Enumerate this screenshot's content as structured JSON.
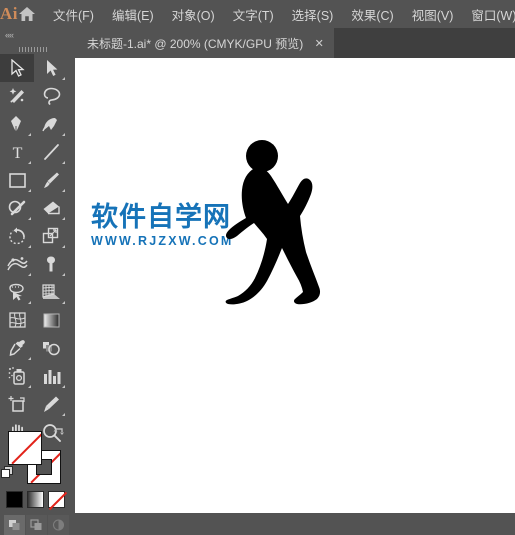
{
  "app": {
    "logo_text": "Ai",
    "home_icon": "home-icon"
  },
  "menubar": {
    "items": [
      {
        "label": "文件(F)",
        "name": "menu-file"
      },
      {
        "label": "编辑(E)",
        "name": "menu-edit"
      },
      {
        "label": "对象(O)",
        "name": "menu-object"
      },
      {
        "label": "文字(T)",
        "name": "menu-type"
      },
      {
        "label": "选择(S)",
        "name": "menu-select"
      },
      {
        "label": "效果(C)",
        "name": "menu-effect"
      },
      {
        "label": "视图(V)",
        "name": "menu-view"
      },
      {
        "label": "窗口(W)",
        "name": "menu-window"
      }
    ]
  },
  "document_tab": {
    "title": "未标题-1.ai* @ 200% (CMYK/GPU 预览)",
    "close_label": "✕",
    "zoom_level": "200%",
    "color_mode": "CMYK",
    "preview_mode": "GPU 预览",
    "filename": "未标题-1.ai*"
  },
  "toolpanel": {
    "collapse_label": "««",
    "tools": [
      {
        "name": "selection-tool",
        "label": "选择工具",
        "active": true,
        "corner": false
      },
      {
        "name": "direct-selection-tool",
        "label": "直接选择工具",
        "active": false,
        "corner": true
      },
      {
        "name": "magic-wand-tool",
        "label": "魔棒工具",
        "active": false,
        "corner": false
      },
      {
        "name": "lasso-tool",
        "label": "套索工具",
        "active": false,
        "corner": false
      },
      {
        "name": "pen-tool",
        "label": "钢笔工具",
        "active": false,
        "corner": true
      },
      {
        "name": "curvature-tool",
        "label": "曲率工具",
        "active": false,
        "corner": true
      },
      {
        "name": "type-tool",
        "label": "文字工具",
        "active": false,
        "corner": true
      },
      {
        "name": "line-segment-tool",
        "label": "直线段工具",
        "active": false,
        "corner": true
      },
      {
        "name": "rectangle-tool",
        "label": "矩形工具",
        "active": false,
        "corner": true
      },
      {
        "name": "paintbrush-tool",
        "label": "画笔工具",
        "active": false,
        "corner": true
      },
      {
        "name": "shaper-tool",
        "label": "Shaper 工具",
        "active": false,
        "corner": true
      },
      {
        "name": "eraser-tool",
        "label": "橡皮擦工具",
        "active": false,
        "corner": true
      },
      {
        "name": "rotate-tool",
        "label": "旋转工具",
        "active": false,
        "corner": true
      },
      {
        "name": "scale-tool",
        "label": "比例缩放工具",
        "active": false,
        "corner": true
      },
      {
        "name": "width-tool",
        "label": "宽度工具",
        "active": false,
        "corner": true
      },
      {
        "name": "free-transform-tool",
        "label": "自由变换工具",
        "active": false,
        "corner": true
      },
      {
        "name": "shape-builder-tool",
        "label": "形状生成器工具",
        "active": false,
        "corner": true
      },
      {
        "name": "perspective-grid-tool",
        "label": "透视网格工具",
        "active": false,
        "corner": true
      },
      {
        "name": "mesh-tool",
        "label": "网格工具",
        "active": false,
        "corner": false
      },
      {
        "name": "gradient-tool",
        "label": "渐变工具",
        "active": false,
        "corner": false
      },
      {
        "name": "eyedropper-tool",
        "label": "吸管工具",
        "active": false,
        "corner": true
      },
      {
        "name": "blend-tool",
        "label": "混合工具",
        "active": false,
        "corner": false
      },
      {
        "name": "symbol-sprayer-tool",
        "label": "符号喷枪工具",
        "active": false,
        "corner": true
      },
      {
        "name": "column-graph-tool",
        "label": "柱形图工具",
        "active": false,
        "corner": true
      },
      {
        "name": "artboard-tool",
        "label": "画板工具",
        "active": false,
        "corner": false
      },
      {
        "name": "slice-tool",
        "label": "切片工具",
        "active": false,
        "corner": true
      },
      {
        "name": "hand-tool",
        "label": "抓手工具",
        "active": false,
        "corner": true
      },
      {
        "name": "zoom-tool",
        "label": "缩放工具",
        "active": false,
        "corner": false
      }
    ],
    "fill": {
      "name": "fill-swatch",
      "value": "无",
      "color": "#ffffff"
    },
    "stroke": {
      "name": "stroke-swatch",
      "value": "无",
      "color": "#ffffff"
    },
    "swap_label": "互换填色和描边",
    "default_label": "默认填色和描边",
    "color_modes": [
      {
        "name": "color-mode-button",
        "label": "颜色",
        "selected": false
      },
      {
        "name": "gradient-mode-button",
        "label": "渐变",
        "selected": false
      },
      {
        "name": "none-mode-button",
        "label": "无",
        "selected": true
      }
    ],
    "draw_modes": [
      {
        "name": "draw-normal-button",
        "label": "正常绘图",
        "selected": true
      },
      {
        "name": "draw-behind-button",
        "label": "背面绘图",
        "selected": false
      },
      {
        "name": "draw-inside-button",
        "label": "内部绘图",
        "selected": false
      }
    ]
  },
  "canvas": {
    "background": "#ffffff",
    "artwork": {
      "name": "walking-person-silhouette",
      "label": "行走人物剪影",
      "color": "#000000"
    },
    "watermark": {
      "chinese": "软件自学网",
      "url": "WWW.RJZXW.COM",
      "color": "#1673b8"
    }
  },
  "colors": {
    "chrome": "#535353",
    "tabbar": "#3f3f3f",
    "text": "#d6d6d6",
    "accent": "#d08c5a",
    "watermark_blue": "#1673b8",
    "none_red": "#e2231a"
  }
}
